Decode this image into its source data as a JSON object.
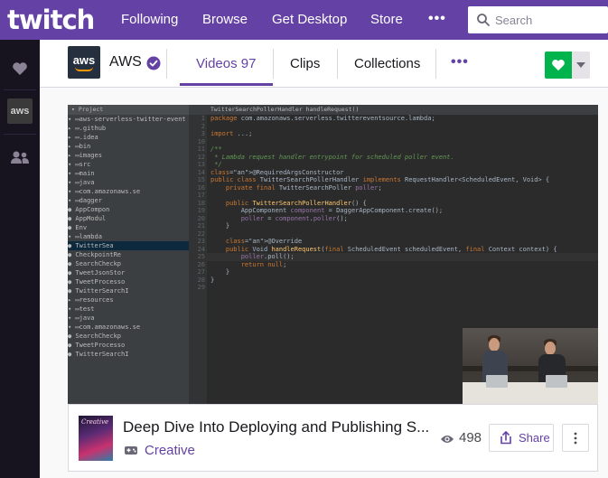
{
  "topnav": {
    "logo_text": "twitch",
    "links": [
      "Following",
      "Browse",
      "Get Desktop",
      "Store"
    ],
    "more_label": "•••",
    "search_placeholder": "Search"
  },
  "channel": {
    "logo_text": "aws",
    "name": "AWS",
    "tabs": {
      "videos_label": "Videos",
      "videos_count": "97",
      "clips_label": "Clips",
      "collections_label": "Collections"
    },
    "more_label": "•••"
  },
  "rail": {
    "items": [
      "heart-icon",
      "aws-channel-thumb",
      "friends-icon"
    ],
    "aws_thumb_text": "aws"
  },
  "player": {
    "tree_header": "▾ Project",
    "tree": [
      "▾ ▭aws-serverless-twitter-event",
      "  ▸ ▭.github",
      "  ▸ ▭.idea",
      "  ▸ ▭bin",
      "  ▸ ▭images",
      "  ▾ ▭src",
      "    ▾ ▭main",
      "      ▾ ▭java",
      "        ▾ ▭com.amazonaws.se",
      "          ▾ ▭dagger",
      "              ● AppCompon",
      "              ● AppModul",
      "              ● Env",
      "          ▾ ▭lambda",
      "              ● TwitterSea",
      "            ● CheckpointRe",
      "            ● SearchCheckp",
      "            ● TweetJsonStor",
      "            ● TweetProcesso",
      "            ● TwitterSearchI",
      "      ▸ ▭resources",
      "    ▾ ▭test",
      "      ▾ ▭java",
      "        ▾ ▭com.amazonaws.se",
      "            ● SearchCheckp",
      "            ● TweetProcesso",
      "            ● TwitterSearchI"
    ],
    "tree_selected_index": 14,
    "code_tab": "TwitterSearchPollerHandler handleRequest()",
    "code": [
      {
        "n": "1",
        "t": "package com.amazonaws.serverless.twittereventsource.lambda;"
      },
      {
        "n": "2",
        "t": ""
      },
      {
        "n": "3",
        "t": "import ...;"
      },
      {
        "n": "10",
        "t": ""
      },
      {
        "n": "11",
        "t": "/**"
      },
      {
        "n": "12",
        "t": " * Lambda request handler entrypoint for scheduled poller event."
      },
      {
        "n": "13",
        "t": " */"
      },
      {
        "n": "14",
        "t": "@RequiredArgsConstructor"
      },
      {
        "n": "15",
        "t": "public class TwitterSearchPollerHandler implements RequestHandler<ScheduledEvent, Void> {"
      },
      {
        "n": "16",
        "t": "    private final TwitterSearchPoller poller;"
      },
      {
        "n": "17",
        "t": ""
      },
      {
        "n": "18",
        "t": "    public TwitterSearchPollerHandler() {"
      },
      {
        "n": "19",
        "t": "        AppComponent component = DaggerAppComponent.create();"
      },
      {
        "n": "20",
        "t": "        poller = component.poller();"
      },
      {
        "n": "21",
        "t": "    }"
      },
      {
        "n": "22",
        "t": ""
      },
      {
        "n": "23",
        "t": "    @Override"
      },
      {
        "n": "24",
        "t": "    public Void handleRequest(final ScheduledEvent scheduledEvent, final Context context) {"
      },
      {
        "n": "25",
        "t": "        poller.poll();"
      },
      {
        "n": "26",
        "t": "        return null;"
      },
      {
        "n": "27",
        "t": "    }"
      },
      {
        "n": "28",
        "t": "}"
      },
      {
        "n": "29",
        "t": ""
      }
    ]
  },
  "video": {
    "title": "Deep Dive Into Deploying and Publishing S...",
    "game_art_text": "Creative",
    "category": "Creative",
    "views": "498",
    "share_label": "Share"
  },
  "colors": {
    "brand": "#6441a4",
    "follow": "#00b34d",
    "rail_bg": "#17141f"
  }
}
